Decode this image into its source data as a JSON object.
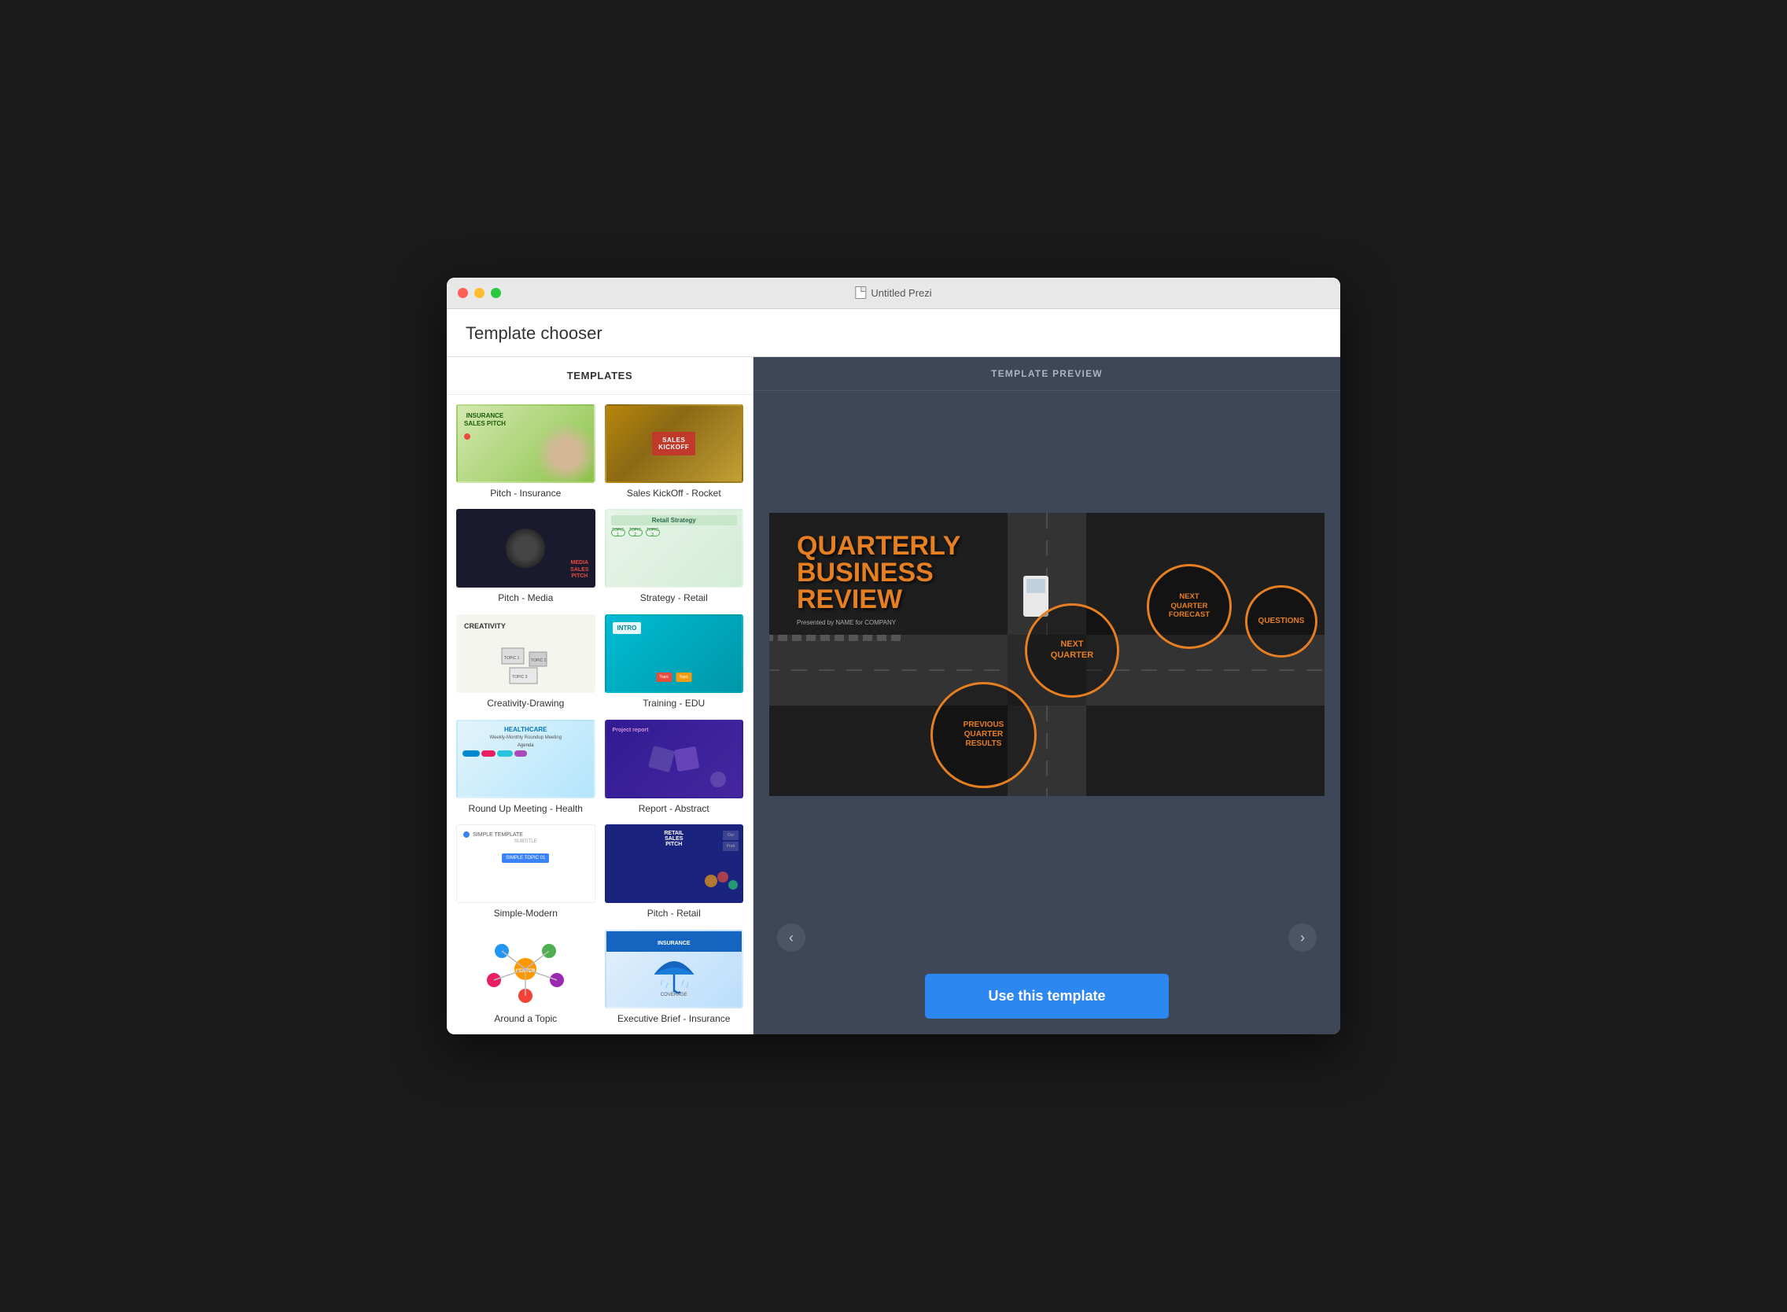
{
  "window": {
    "title": "Untitled Prezi",
    "traffic_lights": [
      "red",
      "yellow",
      "green"
    ]
  },
  "app": {
    "title": "Template chooser"
  },
  "templates_panel": {
    "header": "TEMPLATES",
    "items": [
      {
        "id": "pitch-insurance",
        "label": "Pitch - Insurance",
        "type": "insurance"
      },
      {
        "id": "sales-kickoff",
        "label": "Sales KickOff - Rocket",
        "type": "kickoff"
      },
      {
        "id": "pitch-media",
        "label": "Pitch - Media",
        "type": "pitch-media"
      },
      {
        "id": "strategy-retail",
        "label": "Strategy - Retail",
        "type": "retail"
      },
      {
        "id": "creativity-drawing",
        "label": "Creativity-Drawing",
        "type": "creativity"
      },
      {
        "id": "training-edu",
        "label": "Training - EDU",
        "type": "training"
      },
      {
        "id": "roundup-health",
        "label": "Round Up Meeting - Health",
        "type": "health"
      },
      {
        "id": "report-abstract",
        "label": "Report - Abstract",
        "type": "abstract"
      },
      {
        "id": "simple-modern",
        "label": "Simple-Modern",
        "type": "simple"
      },
      {
        "id": "pitch-retail",
        "label": "Pitch - Retail",
        "type": "pitch-retail"
      },
      {
        "id": "around-topic",
        "label": "Around a Topic",
        "type": "around"
      },
      {
        "id": "exec-brief-insurance",
        "label": "Executive Brief - Insurance",
        "type": "exec"
      }
    ]
  },
  "preview": {
    "header": "TEMPLATE PREVIEW",
    "title_line1": "QUARTERLY",
    "title_line2": "BUSINESS",
    "title_line3": "REVIEW",
    "subtitle": "Presented by NAME for COMPANY",
    "circles": [
      {
        "label": "NEXT\nQUARTER",
        "class": "circle-next-quarter"
      },
      {
        "label": "PREVIOUS\nQUARTER\nRESULTS",
        "class": "circle-prev-results"
      },
      {
        "label": "NEXT\nQUARTER\nFORECAST",
        "class": "circle-forecast"
      },
      {
        "label": "QUESTIONS",
        "class": "circle-questions"
      }
    ],
    "nav_prev": "‹",
    "nav_next": "›"
  },
  "actions": {
    "use_template": "Use this template"
  }
}
